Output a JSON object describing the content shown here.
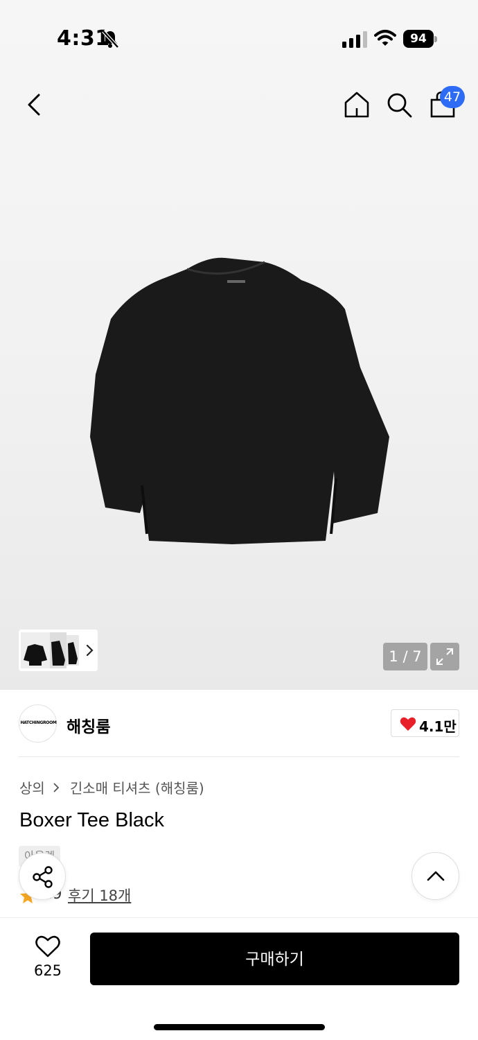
{
  "status_bar": {
    "time": "4:31",
    "battery": "94",
    "icons": [
      "bell-off-icon",
      "signal-icon",
      "wifi-icon",
      "battery-icon"
    ]
  },
  "nav": {
    "icons": [
      "chevron-left-icon",
      "home-icon",
      "search-icon",
      "shopping-bag-icon"
    ],
    "cart_count": "47"
  },
  "gallery": {
    "counter": "1 / 7",
    "thumbnail_count": 3
  },
  "brand": {
    "logo_text": "HATCHINGROOM",
    "name": "해칭룸",
    "likes": "4.1만"
  },
  "product": {
    "breadcrumb": [
      "상의",
      "긴소매 티셔츠 (해칭룸)"
    ],
    "title": "Boxer Tee Black",
    "tag": "아울렛",
    "rating": "4.9",
    "reviews": "후기 18개"
  },
  "bottom_bar": {
    "wish_count": "625",
    "buy_label": "구매하기"
  },
  "colors": {
    "badge": "#2f6cf6",
    "heart": "#e8202a",
    "star": "#f5a623",
    "buy_button": "#000000"
  }
}
